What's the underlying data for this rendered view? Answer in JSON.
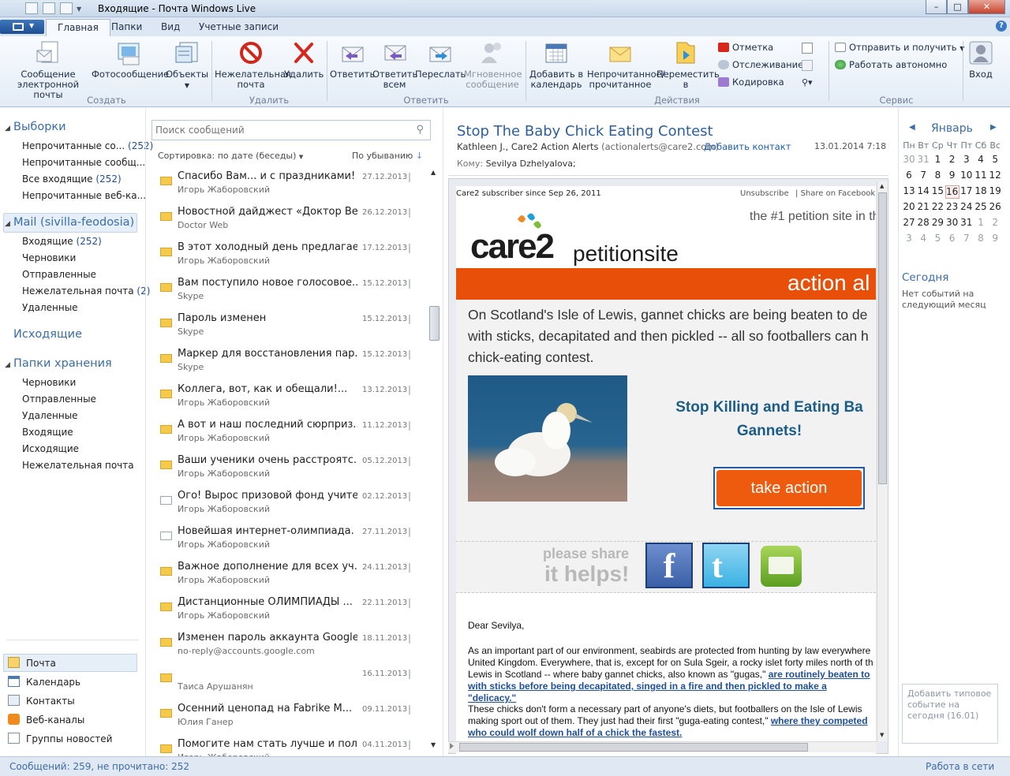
{
  "window": {
    "title": "Входящие - Почта Windows Live",
    "minimize": "–",
    "maximize": "□",
    "close": "✕",
    "help": "?"
  },
  "tabs": [
    "Главная",
    "Папки",
    "Вид",
    "Учетные записи"
  ],
  "ribbon": {
    "create": {
      "new_email": "Сообщение электронной почты",
      "photo_email": "Фотосообщение",
      "items": "Объекты",
      "group": "Создать"
    },
    "delete": {
      "junk": "Нежелательная почта",
      "delete": "Удалить",
      "group": "Удалить"
    },
    "respond": {
      "reply": "Ответить",
      "reply_all": "Ответить всем",
      "forward": "Переслать",
      "instant": "Мгновенное сообщение",
      "group": "Ответить"
    },
    "actions": {
      "add_calendar": "Добавить в календарь",
      "mark": "Непрочитанное/ прочитанное",
      "move": "Переместить в",
      "flag": "Отметка",
      "watch": "Отслеживание",
      "encoding": "Кодировка",
      "group": "Действия"
    },
    "tools": {
      "send_receive": "Отправить и получить",
      "offline": "Работать автономно",
      "group": "Сервис"
    },
    "signin": "Вход"
  },
  "nav": {
    "views_header": "Выборки",
    "views": [
      {
        "label": "Непрочитанные со...",
        "count": "(252)"
      },
      {
        "label": "Непрочитанные сообщ...",
        "count": ""
      },
      {
        "label": "Все входящие",
        "count": "(252)"
      },
      {
        "label": "Непрочитанные веб-ка...",
        "count": ""
      }
    ],
    "account_header": "Mail (sivilla-feodosia)",
    "account_folders": [
      {
        "label": "Входящие",
        "count": "(252)"
      },
      {
        "label": "Черновики",
        "count": ""
      },
      {
        "label": "Отправленные",
        "count": ""
      },
      {
        "label": "Нежелательная почта",
        "count": "(2)"
      },
      {
        "label": "Удаленные",
        "count": ""
      }
    ],
    "outbox": "Исходящие",
    "storage_header": "Папки хранения",
    "storage_folders": [
      "Черновики",
      "Отправленные",
      "Удаленные",
      "Входящие",
      "Исходящие",
      "Нежелательная почта"
    ],
    "bottom": [
      "Почта",
      "Календарь",
      "Контакты",
      "Веб-каналы",
      "Группы новостей"
    ]
  },
  "list": {
    "search_placeholder": "Поиск сообщений",
    "sort": "Сортировка: по дате (беседы)",
    "order": "По убыванию",
    "messages": [
      {
        "subject": "Спасибо Вам... и с праздниками! ...",
        "from": "Игорь Жаборовский",
        "date": "27.12.2013",
        "open": false
      },
      {
        "subject": "Новостной дайджест «Доктор Ве...",
        "from": "Doctor Web",
        "date": "26.12.2013",
        "open": false
      },
      {
        "subject": "В этот холодный день предлагае...",
        "from": "Игорь Жаборовский",
        "date": "17.12.2013",
        "open": false
      },
      {
        "subject": "Вам поступило новое голосовое...",
        "from": "Skype",
        "date": "15.12.2013",
        "open": false
      },
      {
        "subject": "Пароль изменен",
        "from": "Skype",
        "date": "15.12.2013",
        "open": false
      },
      {
        "subject": "Маркер для восстановления пар...",
        "from": "Skype",
        "date": "15.12.2013",
        "open": false
      },
      {
        "subject": "Коллега, вот, как и обещали!...",
        "from": "Игорь Жаборовский",
        "date": "13.12.2013",
        "open": false
      },
      {
        "subject": "А вот и наш последний сюрприз...",
        "from": "Игорь Жаборовский",
        "date": "11.12.2013",
        "open": false
      },
      {
        "subject": "Ваши ученики очень расстроятс...",
        "from": "Игорь Жаборовский",
        "date": "05.12.2013",
        "open": false
      },
      {
        "subject": "Ого! Вырос призовой фонд учите...",
        "from": "Игорь Жаборовский",
        "date": "02.12.2013",
        "open": true
      },
      {
        "subject": "Новейшая интернет-олимпиада. ...",
        "from": "Игорь Жаборовский",
        "date": "27.11.2013",
        "open": true
      },
      {
        "subject": "Важное дополнение для всех уч...",
        "from": "Игорь Жаборовский",
        "date": "24.11.2013",
        "open": false
      },
      {
        "subject": "Дистанционные ОЛИМПИАДЫ ...",
        "from": "Игорь Жаборовский",
        "date": "22.11.2013",
        "open": false
      },
      {
        "subject": "Изменен пароль аккаунта Google",
        "from": "no-reply@accounts.google.com",
        "date": "18.11.2013",
        "open": false
      },
      {
        "subject": "",
        "from": "Таиса Арушанян",
        "date": "16.11.2013",
        "open": false
      },
      {
        "subject": "Осенний ценопад на Fabrike M...",
        "from": "Юлия Ганер",
        "date": "09.11.2013",
        "open": false
      },
      {
        "subject": "Помогите нам стать лучше и пол...",
        "from": "Игорь Жаборовский",
        "date": "04.11.2013",
        "open": false
      }
    ]
  },
  "reading": {
    "subject": "Stop The Baby Chick Eating Contest",
    "from": "Kathleen J., Care2 Action Alerts",
    "email": "(actionalerts@care2.com)",
    "add_contact": "Добавить контакт",
    "date": "13.01.2014 7:18",
    "to_label": "Кому:",
    "to": "Sevilya Dzhelyalova;",
    "mail": {
      "since": "Care2 subscriber since Sep 26, 2011",
      "unsubscribe": "Unsubscribe",
      "share_fb": "Share on Facebook",
      "logo_a": "care2",
      "logo_b": "petitionsite",
      "tagline": "the #1 petition site in th",
      "banner": "action al",
      "lead": "On Scotland's Isle of Lewis, gannet chicks are being beaten to de with sticks, decapitated and then pickled -- all so footballers can h chick-eating contest.",
      "headline": "Stop Killing and Eating Ba Gannets!",
      "cta": "take action",
      "share1": "please share",
      "share2": "it helps!",
      "dear": "Dear Sevilya,",
      "p1": "As an important part of our environment, seabirds are protected from hunting by law everywhere United Kingdom. Everywhere, that is, except for on Sula Sgeir, a rocky islet forty miles north of th Lewis in Scotland -- where baby gannet chicks, also known as \"gugas,\"",
      "p1_link": "are routinely beaten to with sticks before being decapitated, singed in a fire and then pickled to make a \"delicacy.\"",
      "p2": "These chicks don't form a necessary part of anyone's diets, but footballers on the Isle of Lewis making sport out of them. They just had their first \"guga-eating contest,\"",
      "p2_link": "where they competed who could wolf down half of a chick the fastest."
    }
  },
  "calendar": {
    "month": "Январь",
    "weekdays": [
      "Пн",
      "Вт",
      "Ср",
      "Чт",
      "Пт",
      "Сб",
      "Вс"
    ],
    "weeks": [
      [
        "30",
        "31",
        "1",
        "2",
        "3",
        "4",
        "5"
      ],
      [
        "6",
        "7",
        "8",
        "9",
        "10",
        "11",
        "12"
      ],
      [
        "13",
        "14",
        "15",
        "16",
        "17",
        "18",
        "19"
      ],
      [
        "20",
        "21",
        "22",
        "23",
        "24",
        "25",
        "26"
      ],
      [
        "27",
        "28",
        "29",
        "30",
        "31",
        "1",
        "2"
      ],
      [
        "3",
        "4",
        "5",
        "6",
        "7",
        "8",
        "9"
      ]
    ],
    "today_label": "Сегодня",
    "no_events": "Нет событий на следующий месяц",
    "add_event": "Добавить типовое событие на сегодня (16.01)"
  },
  "status": {
    "left": "Сообщений: 259, не прочитано: 252",
    "right": "Работа в сети"
  },
  "colors": {
    "accent": "#3a6ea8",
    "orange": "#e8500a",
    "cta": "#ee5a0e",
    "link": "#1f4f9a"
  }
}
